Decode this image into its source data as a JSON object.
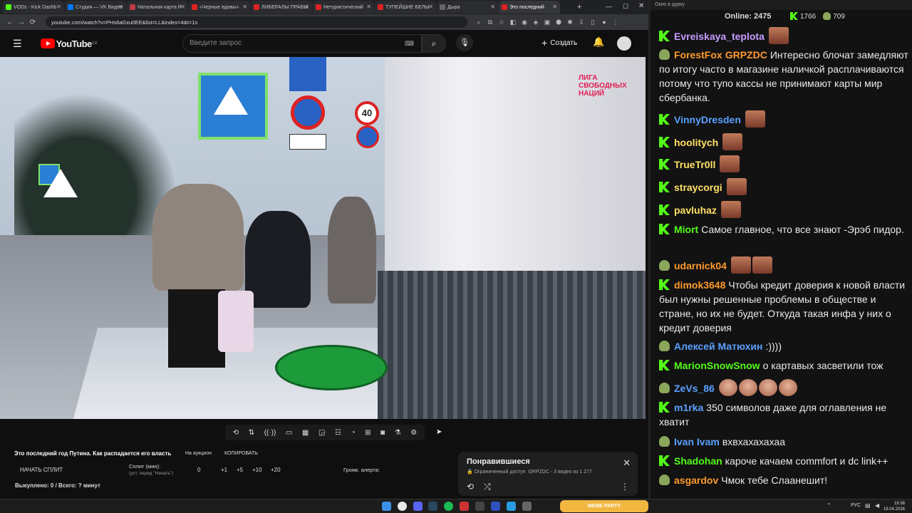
{
  "browser": {
    "tabs": [
      {
        "label": "VODs - Kick Dashb",
        "color": "#53fc18"
      },
      {
        "label": "Студия — VK Видео",
        "color": "#0077ff"
      },
      {
        "label": "Натальная карта R",
        "color": "#c23a4a"
      },
      {
        "label": "«Черные вдовы» ",
        "color": "#d22"
      },
      {
        "label": "ЛИБЕРАЛЫ ПРАВЫ",
        "color": "#d22"
      },
      {
        "label": "Нетуристический",
        "color": "#d22"
      },
      {
        "label": "ТУПЕЙШИЕ БЕЛЫ",
        "color": "#d22"
      },
      {
        "label": "Дыра",
        "color": "#666"
      },
      {
        "label": "Это последний",
        "color": "#d22"
      }
    ],
    "url": "youtube.com/watch?v=PHs6aGxu0EE&list=LL&index=4&t=1s"
  },
  "youtube": {
    "logo": "YouTube",
    "region": "LV",
    "search_placeholder": "Введите запрос",
    "create_label": "Создать"
  },
  "video": {
    "watermark": "ЛИГА СВОБОДНЫХ НАЦИЙ",
    "speed_sign": "40"
  },
  "below": {
    "title": "Это последний год Путина. Как распадается его власть",
    "auction": "На аукцион",
    "copy": "КОПИРОВАТЬ",
    "split_start": "НАЧАТЬ СПЛИТ",
    "split_label": "Сплит (мин):",
    "split_hint": "(уст. перед \"Начать\")",
    "split_value": "0",
    "split_steps": [
      "+1",
      "+5",
      "+10",
      "+20"
    ],
    "alert": "Громк. алерта:",
    "bought": "Выкуплено: 0 / Всего: ? минут"
  },
  "liked": {
    "title": "Понравившиеся",
    "access": "Ограниченный доступ",
    "meta": "GRPZDC - 3 видео из 1 277"
  },
  "chat": {
    "window_title": "Окно в дурку",
    "online_label": "Online:",
    "online_value": "2475",
    "count_a": "1766",
    "count_b": "709",
    "messages": [
      {
        "badge": "k",
        "name": "Evreiskaya_teplota",
        "color": "#c79cff",
        "text": "",
        "emotes": 1
      },
      {
        "badge": "frog",
        "name": "ForestFox",
        "color": "#ff9a2e",
        "extra": "GRPZDC",
        "text": "Интересно блочат замедляют по итогу часто в магазине наличкой расплачиваются потому что тупо кассы не принимают карты мир сбербанка.",
        "emotes": 0
      },
      {
        "badge": "k",
        "name": "VinnyDresden",
        "color": "#5aa0ff",
        "text": "",
        "emotes": 1
      },
      {
        "badge": "k",
        "name": "hoolitych",
        "color": "#ffe066",
        "text": "",
        "emotes": 1
      },
      {
        "badge": "k",
        "name": "TrueTr0ll",
        "color": "#ffe066",
        "text": "",
        "emotes": 1
      },
      {
        "badge": "k",
        "name": "straycorgi",
        "color": "#ffe066",
        "text": "",
        "emotes": 1
      },
      {
        "badge": "k",
        "name": "pavluhaz",
        "color": "#ffe066",
        "text": "",
        "emotes": 1
      },
      {
        "badge": "k",
        "name": "Miort",
        "color": "#53fc18",
        "text": "Самое главное, что все знают -Эрэб пидор.",
        "emotes": 0
      },
      {
        "badge": "frog",
        "name": "udarnick04",
        "color": "#ff9a2e",
        "text": "",
        "emotes": 2
      },
      {
        "badge": "k",
        "name": "dimok3648",
        "color": "#ff9a2e",
        "text": "Чтобы кредит доверия к новой власти был нужны решенные проблемы в обществе и стране, но их не будет. Откуда такая инфа у них о кредит доверия",
        "emotes": 0
      },
      {
        "badge": "frog",
        "name": "Алексей Матюхин",
        "color": "#5aa0ff",
        "text": ":))))",
        "emotes": 0
      },
      {
        "badge": "k",
        "name": "MarionSnowSnow",
        "color": "#53fc18",
        "text": "о картавых засветили тож",
        "emotes": 0
      },
      {
        "badge": "frog",
        "name": "ZeVs_86",
        "color": "#5aa0ff",
        "text": "",
        "emotes": 4
      },
      {
        "badge": "k",
        "name": "m1rka",
        "color": "#5aa0ff",
        "text": "350 символов даже для оглавления не хватит",
        "emotes": 0
      },
      {
        "badge": "frog",
        "name": "Ivan Ivam",
        "color": "#5aa0ff",
        "text": "вхвхахахахаа",
        "emotes": 0
      },
      {
        "badge": "k",
        "name": "Shadohan",
        "color": "#53fc18",
        "text": "кароче качаем commfort и dc link++",
        "emotes": 0
      },
      {
        "badge": "frog",
        "name": "asgardov",
        "color": "#ff9a2e",
        "text": "Чмок тебе Слаанешит!",
        "emotes": 0
      }
    ]
  },
  "taskbar": {
    "lang": "РУС",
    "time": "18:38",
    "date": "19.04.2026",
    "banner": "MEME PARTY"
  }
}
